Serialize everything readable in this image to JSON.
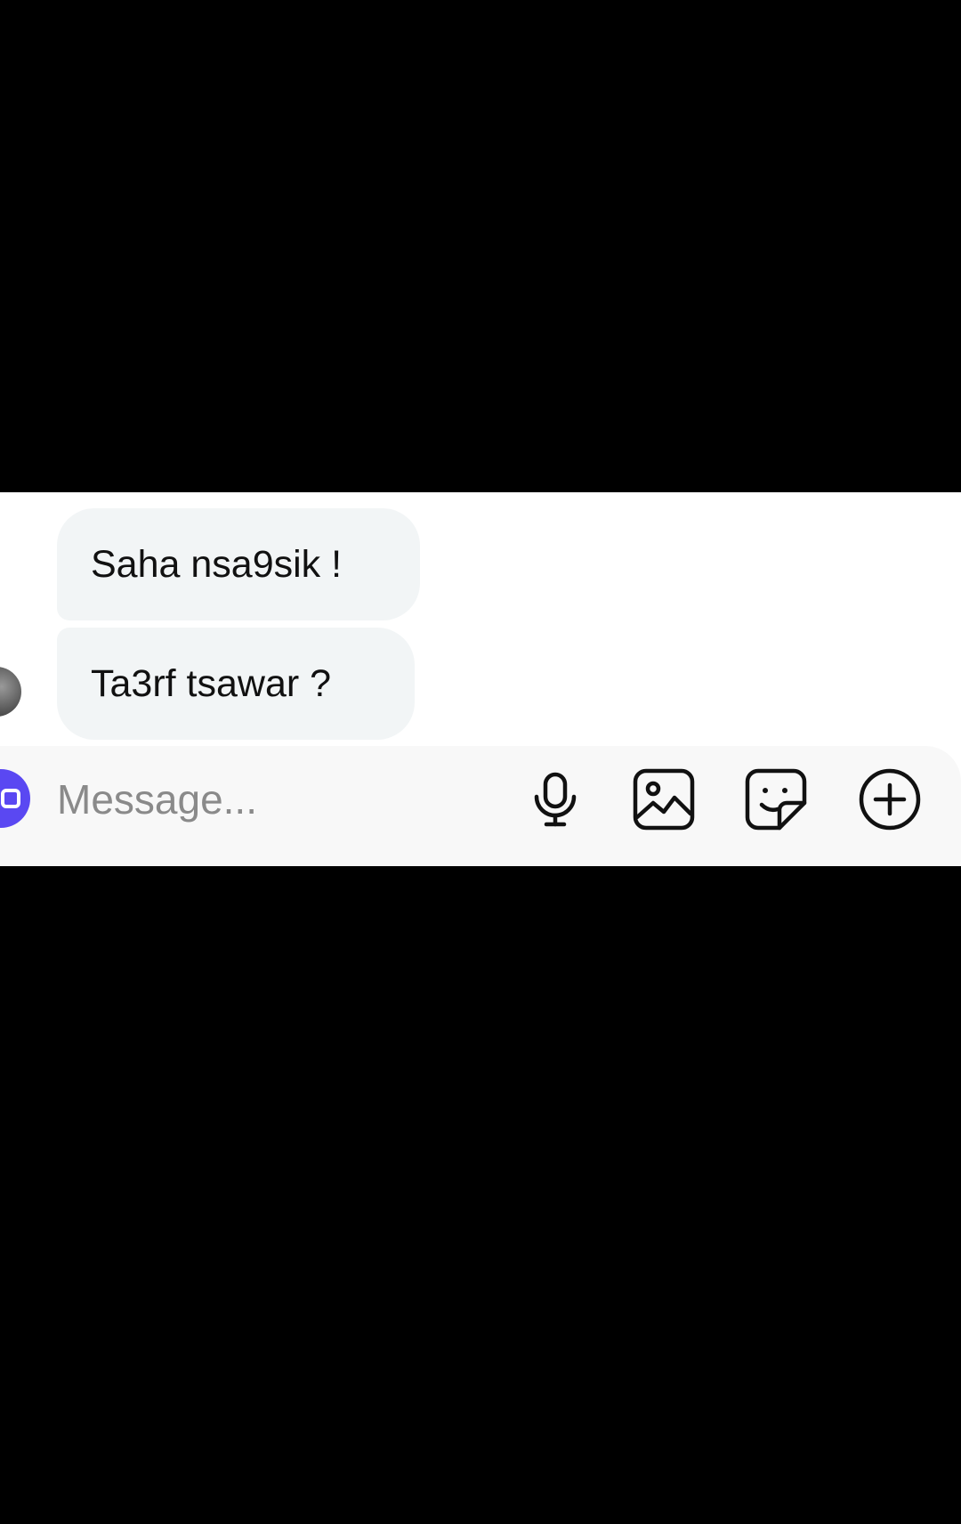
{
  "conversation": {
    "messages": [
      {
        "text": "Saha nsa9sik !"
      },
      {
        "text": "Ta3rf tsawar ?"
      }
    ]
  },
  "composer": {
    "placeholder": "Message...",
    "accent_color": "#5a48f2",
    "icons": [
      "camera-icon",
      "microphone-icon",
      "gallery-icon",
      "sticker-icon",
      "plus-icon"
    ]
  }
}
